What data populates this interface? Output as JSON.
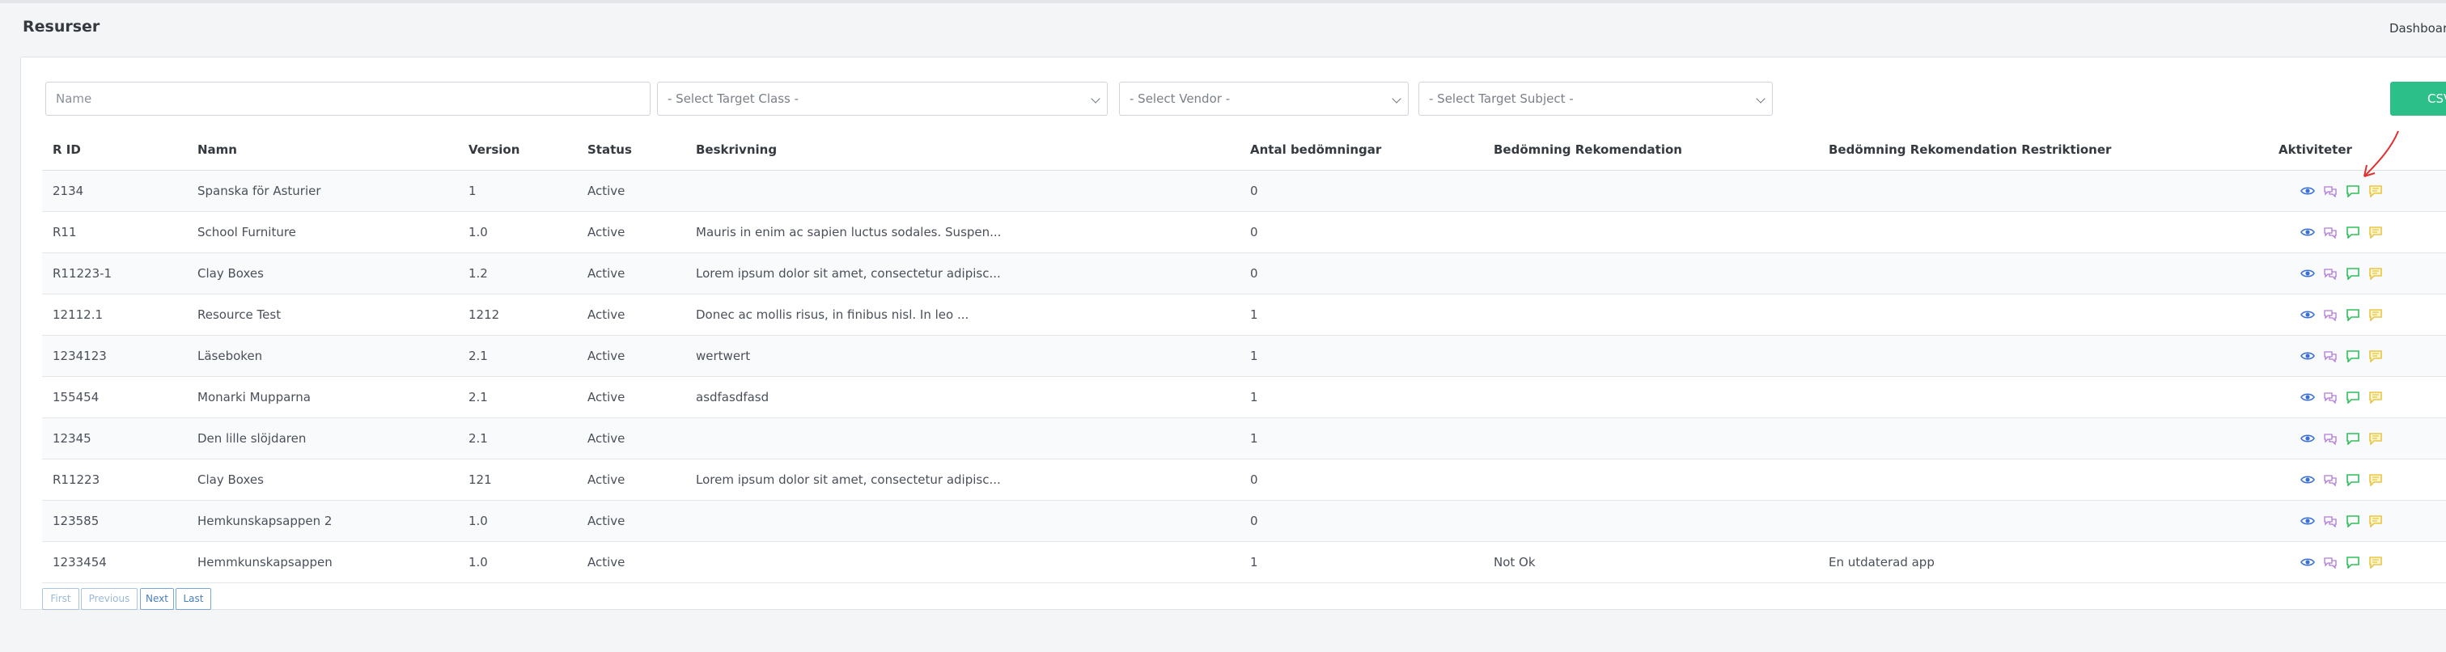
{
  "page": {
    "title": "Resurser",
    "breadcrumb": "Dashboard"
  },
  "filters": {
    "name_placeholder": "Name",
    "target_class": "- Select Target Class -",
    "vendor": "- Select Vendor -",
    "target_subject": "- Select Target Subject -",
    "csv_label": "CSV"
  },
  "table": {
    "headers": [
      "R ID",
      "Namn",
      "Version",
      "Status",
      "Beskrivning",
      "Antal bedömningar",
      "Bedömning Rekomendation",
      "Bedömning Rekomendation Restriktioner",
      "Aktiviteter"
    ],
    "rows": [
      {
        "rid": "2134",
        "namn": "Spanska för Asturier",
        "version": "1",
        "status": "Active",
        "beskrivning": "",
        "antal": "0",
        "rek": "",
        "restr": ""
      },
      {
        "rid": "R11",
        "namn": "School Furniture",
        "version": "1.0",
        "status": "Active",
        "beskrivning": "Mauris in enim ac sapien luctus sodales. Suspen...",
        "antal": "0",
        "rek": "",
        "restr": ""
      },
      {
        "rid": "R11223-1",
        "namn": "Clay Boxes",
        "version": "1.2",
        "status": "Active",
        "beskrivning": "Lorem ipsum dolor sit amet, consectetur adipisc...",
        "antal": "0",
        "rek": "",
        "restr": ""
      },
      {
        "rid": "12112.1",
        "namn": "Resource Test",
        "version": "1212",
        "status": "Active",
        "beskrivning": "Donec ac mollis risus, in finibus nisl. In leo ...",
        "antal": "1",
        "rek": "",
        "restr": ""
      },
      {
        "rid": "1234123",
        "namn": "Läseboken",
        "version": "2.1",
        "status": "Active",
        "beskrivning": "wertwert",
        "antal": "1",
        "rek": "",
        "restr": ""
      },
      {
        "rid": "155454",
        "namn": "Monarki Mupparna",
        "version": "2.1",
        "status": "Active",
        "beskrivning": "asdfasdfasd",
        "antal": "1",
        "rek": "",
        "restr": ""
      },
      {
        "rid": "12345",
        "namn": "Den lille slöjdaren",
        "version": "2.1",
        "status": "Active",
        "beskrivning": "",
        "antal": "1",
        "rek": "",
        "restr": ""
      },
      {
        "rid": "R11223",
        "namn": "Clay Boxes",
        "version": "121",
        "status": "Active",
        "beskrivning": "Lorem ipsum dolor sit amet, consectetur adipisc...",
        "antal": "0",
        "rek": "",
        "restr": ""
      },
      {
        "rid": "123585",
        "namn": "Hemkunskapsappen 2",
        "version": "1.0",
        "status": "Active",
        "beskrivning": "",
        "antal": "0",
        "rek": "",
        "restr": ""
      },
      {
        "rid": "1233454",
        "namn": "Hemmkunskapsappen",
        "version": "1.0",
        "status": "Active",
        "beskrivning": "",
        "antal": "1",
        "rek": "Not Ok",
        "restr": "En utdaterad app"
      }
    ],
    "action_icons": [
      "eye-icon",
      "comments-icon",
      "comment-green-icon",
      "comment-yellow-icon"
    ]
  },
  "pagination": {
    "first": "First",
    "previous": "Previous",
    "next": "Next",
    "last": "Last"
  },
  "colors": {
    "accent_green": "#2dbf8a",
    "eye_blue": "#3b6fd8",
    "comments_purple": "#b07ad8",
    "comment_green": "#2fbf5a",
    "comment_yellow": "#e7c64a",
    "annotation_red": "#e03131"
  }
}
